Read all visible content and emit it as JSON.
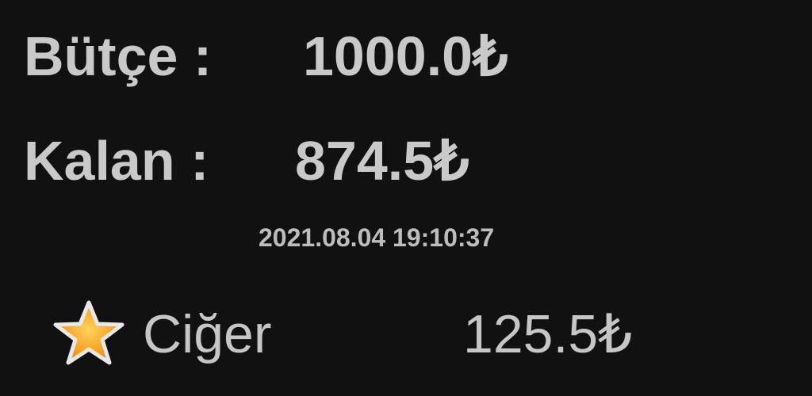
{
  "budget": {
    "label": "Bütçe :",
    "value": "1000.0₺"
  },
  "remaining": {
    "label": "Kalan :",
    "value": "874.5₺"
  },
  "timestamp": "2021.08.04 19:10:37",
  "expenses": [
    {
      "icon": "star-icon",
      "name": "Ciğer",
      "amount": "125.5₺"
    }
  ],
  "colors": {
    "background": "#111111",
    "text": "#c9c9c9",
    "star_fill": "#f5a623",
    "star_outline": "#e8e8e8"
  }
}
